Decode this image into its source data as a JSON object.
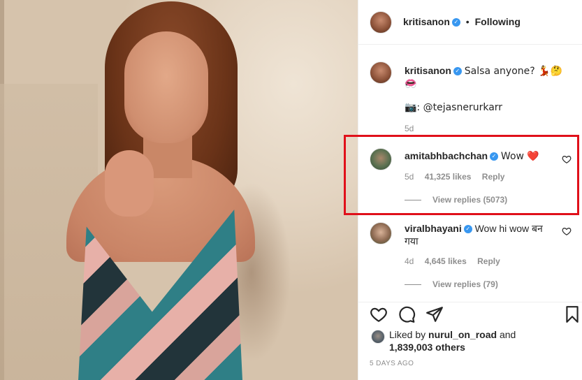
{
  "post": {
    "author": "kritisanon",
    "follow_label": "Following",
    "separator": "•"
  },
  "caption": {
    "author": "kritisanon",
    "text": "Salsa anyone? 💃🤔👀",
    "line2": "👄",
    "credit": "📷: @tejasnerurkarr",
    "age": "5d"
  },
  "comments": [
    {
      "author": "amitabhbachchan",
      "text": "Wow ❤️",
      "age": "5d",
      "likes": "41,325 likes",
      "reply": "Reply",
      "view_replies": "View replies (5073)"
    },
    {
      "author": "viralbhayani",
      "text": "Wow hi wow बन गया",
      "age": "4d",
      "likes": "4,645 likes",
      "reply": "Reply",
      "view_replies": "View replies (79)"
    }
  ],
  "liked_by": {
    "prefix": "Liked by",
    "user": "nurul_on_road",
    "and": "and",
    "others": "1,839,003 others"
  },
  "timestamp": "5 DAYS AGO",
  "icons": {
    "verified": "verified-badge-icon",
    "like": "heart-icon",
    "comment": "comment-bubble-icon",
    "share": "paper-plane-icon",
    "save": "bookmark-icon"
  },
  "colors": {
    "highlight": "#e0101a",
    "verified": "#3897f0",
    "muted": "#8e8e8e",
    "heart": "#d7262e"
  }
}
